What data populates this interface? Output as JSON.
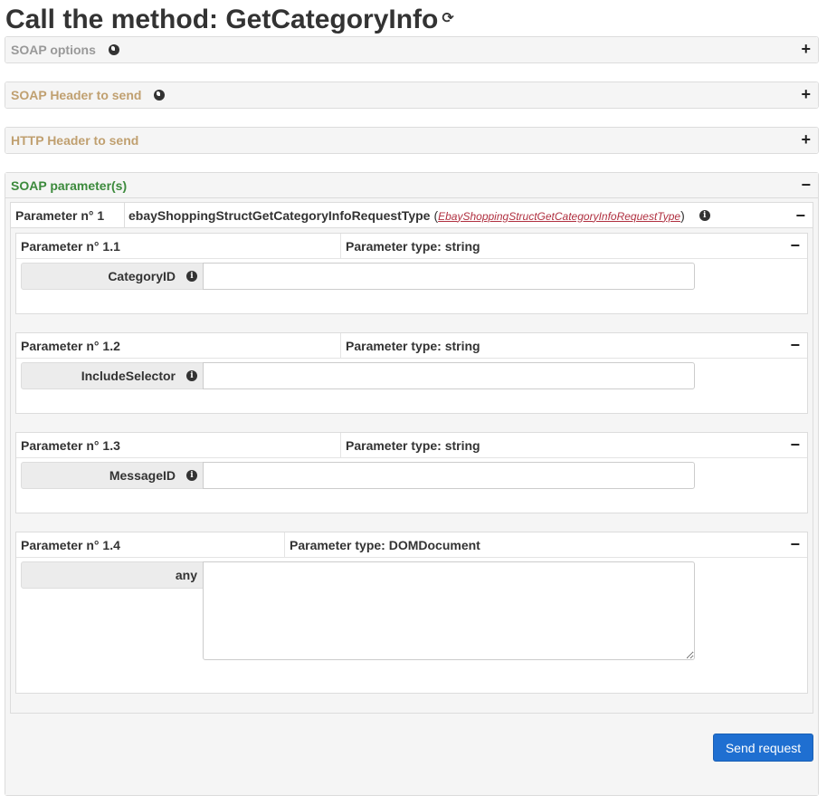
{
  "title": "Call the method: GetCategoryInfo",
  "refresh_icon": "refresh-icon",
  "panels": {
    "soap_options": {
      "label": "SOAP options",
      "toggle": "+"
    },
    "soap_header": {
      "label": "SOAP Header to send",
      "toggle": "+"
    },
    "http_header": {
      "label": "HTTP Header to send",
      "toggle": "+"
    },
    "soap_params": {
      "label": "SOAP parameter(s)",
      "toggle": "−"
    }
  },
  "param1": {
    "number": "Parameter n° 1",
    "name": "ebayShoppingStructGetCategoryInfoRequestType",
    "paren_open": "(",
    "type": "EbayShoppingStructGetCategoryInfoRequestType",
    "paren_close": ")",
    "toggle": "−"
  },
  "subparams": [
    {
      "number": "Parameter n° 1.1",
      "type": "Parameter type: string",
      "field": "CategoryID",
      "value": "",
      "toggle": "−"
    },
    {
      "number": "Parameter n° 1.2",
      "type": "Parameter type: string",
      "field": "IncludeSelector",
      "value": "",
      "toggle": "−"
    },
    {
      "number": "Parameter n° 1.3",
      "type": "Parameter type: string",
      "field": "MessageID",
      "value": "",
      "toggle": "−"
    },
    {
      "number": "Parameter n° 1.4",
      "type": "Parameter type: DOMDocument",
      "field": "any",
      "value": "",
      "toggle": "−"
    }
  ],
  "send_button": "Send request",
  "colors": {
    "accent_button": "#1f6fd1",
    "header_gold": "#c0a070",
    "header_green": "#3c8a3c",
    "type_red": "#b03040"
  }
}
